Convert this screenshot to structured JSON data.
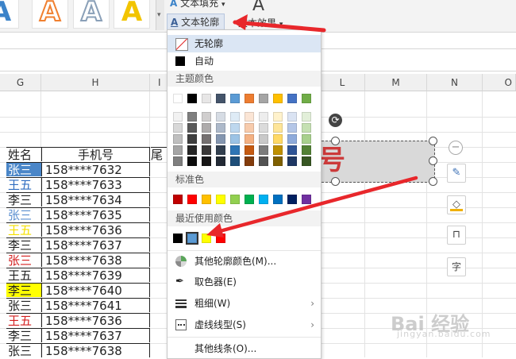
{
  "ribbon": {
    "text_fill_label": "文本填充",
    "text_outline_label": "文本轮廓",
    "text_effect_label": "文本效果",
    "dropdown_arrow": "▾",
    "wordart_letter": "A",
    "wordart_colors": [
      "#3b83c9",
      "#f08030",
      "#8aa0b8",
      "#f2c400"
    ]
  },
  "columns": [
    "G",
    "H",
    "I",
    "L",
    "M",
    "N",
    "O"
  ],
  "sheet": {
    "header_name": "姓名",
    "header_phone": "手机号",
    "header_tail": "尾数",
    "rows": [
      {
        "name": "张三",
        "phone": "158****7632",
        "style": "blue-fill"
      },
      {
        "name": "王五",
        "phone": "158****7633",
        "style": "blue-text"
      },
      {
        "name": "李三",
        "phone": "158****7634",
        "style": "normal"
      },
      {
        "name": "张三",
        "phone": "158****7635",
        "style": "blue-text"
      },
      {
        "name": "王五",
        "phone": "158****7636",
        "style": "yellow-text"
      },
      {
        "name": "李三",
        "phone": "158****7637",
        "style": "normal"
      },
      {
        "name": "张三",
        "phone": "158****7638",
        "style": "red-text"
      },
      {
        "name": "王五",
        "phone": "158****7639",
        "style": "normal"
      },
      {
        "name": "李三",
        "phone": "158****7640",
        "style": "yellow-fill"
      },
      {
        "name": "张三",
        "phone": "158****7641",
        "style": "normal"
      },
      {
        "name": "王五",
        "phone": "158****7636",
        "style": "red-text"
      },
      {
        "name": "李三",
        "phone": "158****7637",
        "style": "normal"
      },
      {
        "name": "张三",
        "phone": "158****7638",
        "style": "normal"
      }
    ]
  },
  "textbox": {
    "visible_text": "号",
    "text_color": "#cc3a3a"
  },
  "menu": {
    "no_outline": "无轮廓",
    "auto": "自动",
    "theme_colors": "主题颜色",
    "standard_colors": "标准色",
    "recent_colors": "最近使用颜色",
    "more_colors": "其他轮廓颜色(M)...",
    "eyedropper": "取色器(E)",
    "weight": "粗细(W)",
    "dash": "虚线线型(S)",
    "more_lines": "其他线条(O)...",
    "submenu_arrow": "›",
    "theme_top": [
      "#ffffff",
      "#000000",
      "#e7e6e6",
      "#44546a",
      "#5b9bd5",
      "#ed7d31",
      "#a5a5a5",
      "#ffc000",
      "#4472c4",
      "#70ad47"
    ],
    "theme_shades": [
      [
        "#f2f2f2",
        "#7f7f7f",
        "#d0cece",
        "#d6dce4",
        "#deebf6",
        "#fbe5d5",
        "#ededed",
        "#fff2cc",
        "#dae3f3",
        "#e2efd9"
      ],
      [
        "#d8d8d8",
        "#595959",
        "#aeabab",
        "#adb9ca",
        "#bdd7ee",
        "#f7cbac",
        "#dbdbdb",
        "#fee599",
        "#b4c6e7",
        "#c5e0b3"
      ],
      [
        "#bfbfbf",
        "#3f3f3f",
        "#757070",
        "#8496b0",
        "#9cc3e5",
        "#f4b183",
        "#c9c9c9",
        "#ffd965",
        "#8eaadb",
        "#a8d08d"
      ],
      [
        "#a5a5a5",
        "#262626",
        "#3a3838",
        "#323f4f",
        "#2e75b5",
        "#c55a11",
        "#7b7b7b",
        "#bf9000",
        "#2f5496",
        "#538135"
      ],
      [
        "#7f7f7f",
        "#0c0c0c",
        "#171616",
        "#222a35",
        "#1e4e79",
        "#833c0b",
        "#525252",
        "#7f6000",
        "#1f3864",
        "#375623"
      ]
    ],
    "standard": [
      "#c00000",
      "#ff0000",
      "#ffc000",
      "#ffff00",
      "#92d050",
      "#00b050",
      "#00b0f0",
      "#0070c0",
      "#002060",
      "#7030a0"
    ],
    "recent": [
      "#000000",
      "#5b9bd5",
      "#ffff00",
      "#ff0000"
    ]
  },
  "watermark": {
    "main": "Bai 经验",
    "sub": "jingyan.baidu.com"
  }
}
